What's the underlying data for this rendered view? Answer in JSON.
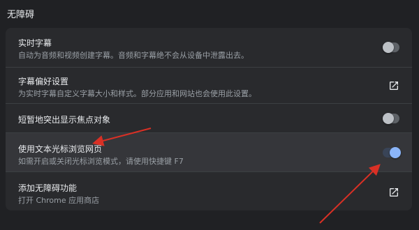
{
  "section": {
    "title": "无障碍"
  },
  "settings": [
    {
      "title": "实时字幕",
      "desc": "自动为音频和视频创建字幕。音频和字幕绝不会从设备中泄露出去。",
      "control": "toggle",
      "state": "off"
    },
    {
      "title": "字幕偏好设置",
      "desc": "为实时字幕自定义字幕大小和样式。部分应用和网站也会使用此设置。",
      "control": "open-in-new-icon"
    },
    {
      "title": "短暂地突出显示焦点对象",
      "control": "toggle",
      "state": "off"
    },
    {
      "title": "使用文本光标浏览网页",
      "desc": "如需开启或关闭光标浏览模式，请使用快捷键 F7",
      "control": "toggle",
      "state": "on"
    },
    {
      "title": "添加无障碍功能",
      "desc": "打开 Chrome 应用商店",
      "control": "open-in-new-icon"
    }
  ],
  "colors": {
    "background": "#202124",
    "card": "#292a2d",
    "toggle_on": "#8ab4f8",
    "toggle_off": "#5f6368",
    "annotation_arrow": "#d93025"
  }
}
